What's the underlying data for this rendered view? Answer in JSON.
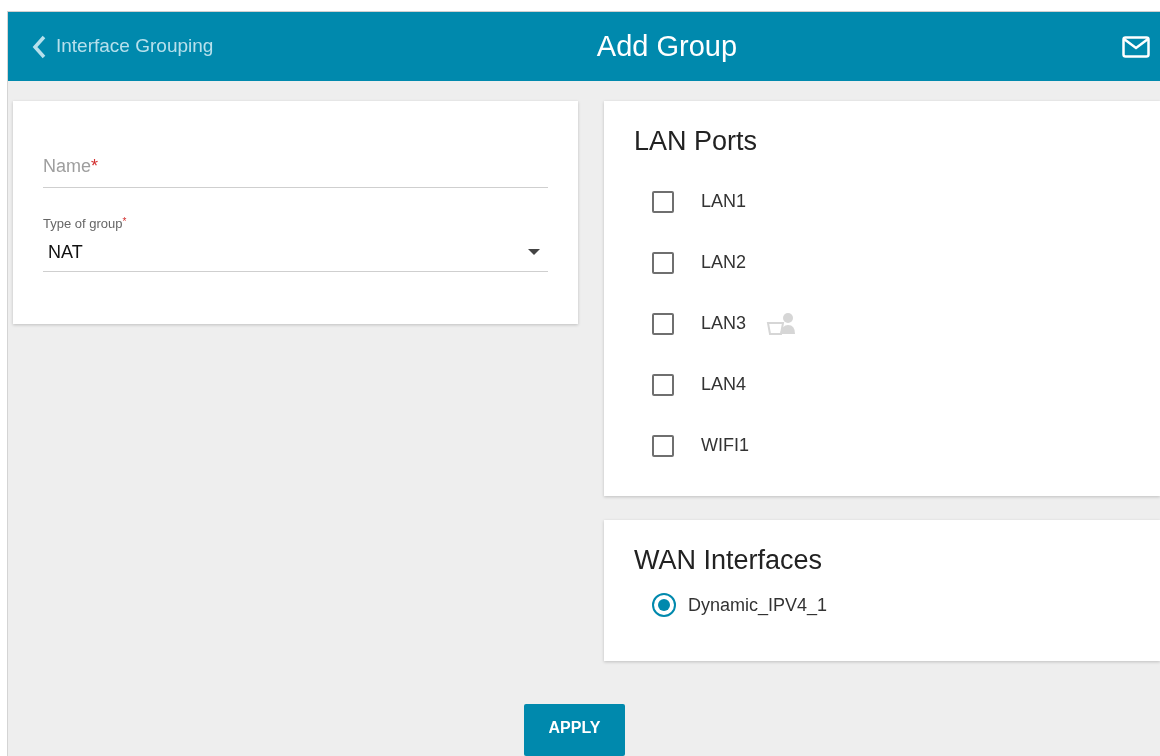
{
  "header": {
    "back_label": "Interface Grouping",
    "title": "Add Group"
  },
  "form": {
    "name_field": {
      "placeholder": "Name",
      "required_mark": "*"
    },
    "type_field": {
      "label": "Type of group",
      "required_mark": "*",
      "value": "NAT"
    }
  },
  "lan_ports": {
    "title": "LAN Ports",
    "items": [
      {
        "label": "LAN1",
        "checked": false,
        "device_connected": false
      },
      {
        "label": "LAN2",
        "checked": false,
        "device_connected": false
      },
      {
        "label": "LAN3",
        "checked": false,
        "device_connected": true
      },
      {
        "label": "LAN4",
        "checked": false,
        "device_connected": false
      },
      {
        "label": "WIFI1",
        "checked": false,
        "device_connected": false
      }
    ]
  },
  "wan_interfaces": {
    "title": "WAN Interfaces",
    "items": [
      {
        "label": "Dynamic_IPV4_1",
        "selected": true
      }
    ]
  },
  "apply_button": "APPLY"
}
